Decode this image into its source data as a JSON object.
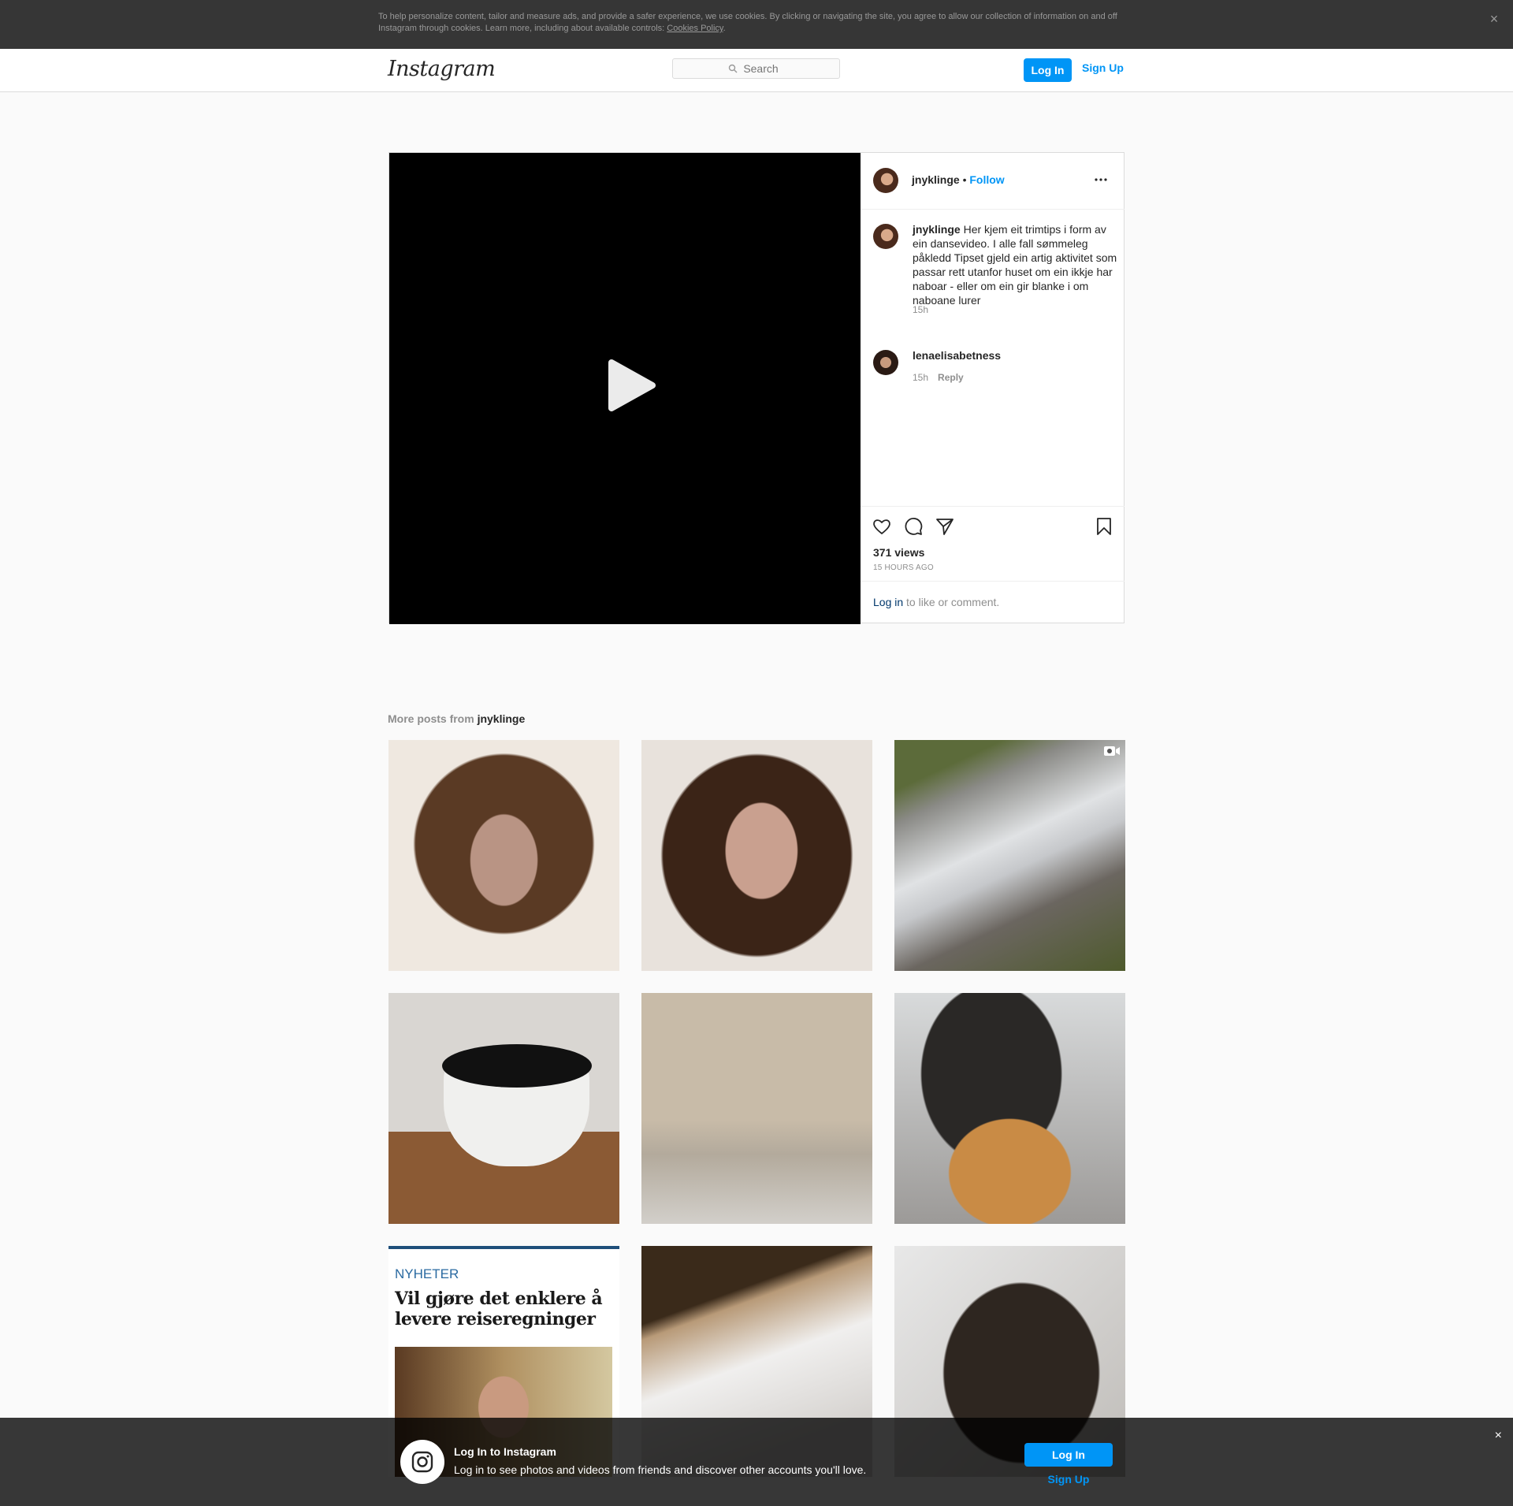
{
  "cookie": {
    "text": "To help personalize content, tailor and measure ads, and provide a safer experience, we use cookies. By clicking or navigating the site, you agree to allow our collection of information on and off Instagram through cookies. Learn more, including about available controls: ",
    "link": "Cookies Policy",
    "close": "×"
  },
  "header": {
    "logo": "Instagram",
    "search_placeholder": "Search",
    "login": "Log In",
    "signup": "Sign Up"
  },
  "post": {
    "username": "jnyklinge",
    "separator": "•",
    "follow": "Follow",
    "caption_user": "jnyklinge",
    "caption": "Her kjem eit trimtips i form av ein dansevideo. I alle fall sømmeleg påkledd Tipset gjeld ein artig aktivitet som passar rett utanfor huset om ein ikkje har naboar - eller om ein gir blanke i om naboane lurer",
    "caption_time": "15h",
    "comment_user": "lenaelisabetness",
    "comment_text": "",
    "comment_time": "15h",
    "comment_reply": "Reply",
    "views": "371 views",
    "ago": "15 HOURS AGO",
    "login_link": "Log in",
    "login_suffix": " to like or comment."
  },
  "more_posts": {
    "prefix": "More posts from ",
    "user": "jnyklinge",
    "tile7_section": "NYHETER",
    "tile7_headline": "Vil gjøre det enklere å levere reiseregninger"
  },
  "bottom_bar": {
    "title": "Log In to Instagram",
    "subtitle": "Log in to see photos and videos from friends and discover other accounts you'll love.",
    "login": "Log In",
    "signup": "Sign Up",
    "close": "×"
  },
  "colors": {
    "accent": "#0095f6",
    "link_dark": "#00376b",
    "muted": "#8e8e8e"
  },
  "icons": [
    "close-icon",
    "search-icon",
    "play-icon",
    "more-options-icon",
    "heart-icon",
    "comment-icon",
    "share-icon",
    "bookmark-icon",
    "video-icon",
    "instagram-camera-icon"
  ]
}
